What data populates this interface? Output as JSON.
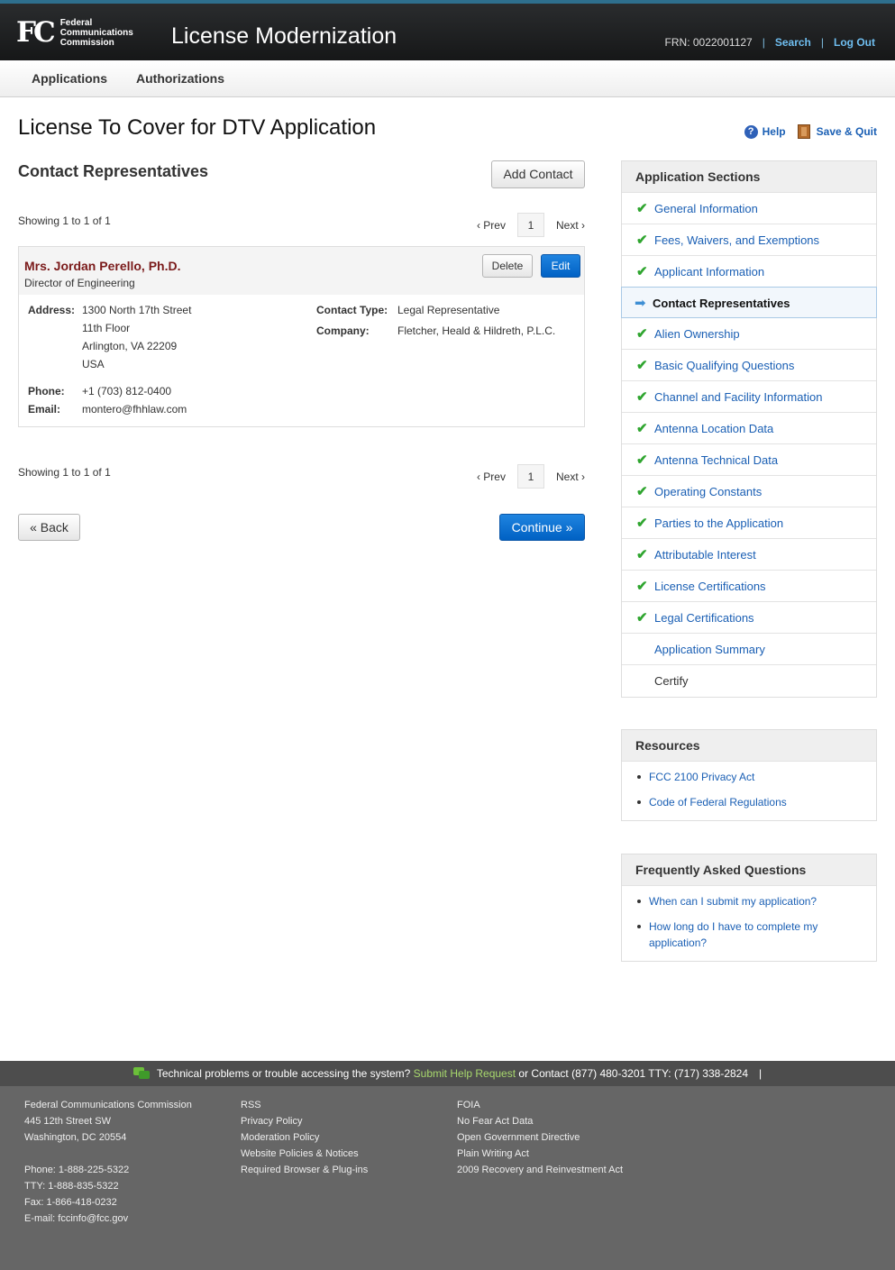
{
  "header": {
    "logo_mark": "FC",
    "logo_lines": [
      "Federal",
      "Communications",
      "Commission"
    ],
    "app_title": "License Modernization",
    "frn": "FRN: 0022001127",
    "separator": "|",
    "search_label": "Search",
    "logout_label": "Log Out"
  },
  "nav": {
    "items": [
      "Applications",
      "Authorizations"
    ]
  },
  "page": {
    "title": "License To Cover for DTV Application",
    "help_label": "Help",
    "save_quit_label": "Save & Quit"
  },
  "contacts": {
    "section_title": "Contact Representatives",
    "add_button": "Add Contact",
    "showing": "Showing 1 to 1 of 1",
    "pager": {
      "prev": "‹ Prev",
      "page": "1",
      "next": "Next ›"
    },
    "card": {
      "name": "Mrs. Jordan Perello, Ph.D.",
      "role": "Director of Engineering",
      "delete_label": "Delete",
      "edit_label": "Edit",
      "address_label": "Address:",
      "address_lines": [
        "1300 North 17th Street",
        "11th Floor",
        "Arlington, VA 22209",
        "USA"
      ],
      "phone_label": "Phone:",
      "phone": "+1 (703) 812-0400",
      "email_label": "Email:",
      "email": "montero@fhhlaw.com",
      "contact_type_label": "Contact Type:",
      "contact_type": "Legal Representative",
      "company_label": "Company:",
      "company": "Fletcher, Heald & Hildreth, P.L.C."
    },
    "back_label": "« Back",
    "continue_label": "Continue »"
  },
  "sidebar": {
    "sections_title": "Application Sections",
    "sections": [
      {
        "label": "General Information",
        "state": "done"
      },
      {
        "label": "Fees, Waivers, and Exemptions",
        "state": "done"
      },
      {
        "label": "Applicant Information",
        "state": "done"
      },
      {
        "label": "Contact Representatives",
        "state": "current"
      },
      {
        "label": "Alien Ownership",
        "state": "done"
      },
      {
        "label": "Basic Qualifying Questions",
        "state": "done"
      },
      {
        "label": "Channel and Facility Information",
        "state": "done"
      },
      {
        "label": "Antenna Location Data",
        "state": "done"
      },
      {
        "label": "Antenna Technical Data",
        "state": "done"
      },
      {
        "label": "Operating Constants",
        "state": "done"
      },
      {
        "label": "Parties to the Application",
        "state": "done"
      },
      {
        "label": "Attributable Interest",
        "state": "done"
      },
      {
        "label": "License Certifications",
        "state": "done"
      },
      {
        "label": "Legal Certifications",
        "state": "done"
      },
      {
        "label": "Application Summary",
        "state": "none"
      },
      {
        "label": "Certify",
        "state": "none-dark"
      }
    ],
    "resources_title": "Resources",
    "resources": [
      "FCC 2100 Privacy Act",
      "Code of Federal Regulations"
    ],
    "faq_title": "Frequently Asked Questions",
    "faq": [
      "When can I submit my application?",
      "How long do I have to complete my application?"
    ]
  },
  "footer": {
    "tech_text": "Technical problems or trouble accessing the system?",
    "help_link": "Submit Help Request",
    "contact_text": "or Contact (877) 480-3201 TTY: (717) 338-2824",
    "bar_sep": "|",
    "col1": [
      "Federal Communications Commission",
      "445 12th Street SW",
      "Washington, DC 20554",
      "",
      "Phone: 1-888-225-5322",
      "TTY: 1-888-835-5322",
      "Fax: 1-866-418-0232",
      "E-mail: fccinfo@fcc.gov"
    ],
    "col2": [
      "RSS",
      "Privacy Policy",
      "Moderation Policy",
      "Website Policies & Notices",
      "Required Browser & Plug-ins"
    ],
    "col3": [
      "FOIA",
      "No Fear Act Data",
      "Open Government Directive",
      "Plain Writing Act",
      "2009 Recovery and Reinvestment Act"
    ]
  },
  "colors": {
    "primary_blue": "#0061c4",
    "link_blue": "#1a5fb4",
    "check_green": "#2fa52f",
    "name_red": "#7a1a1a"
  }
}
